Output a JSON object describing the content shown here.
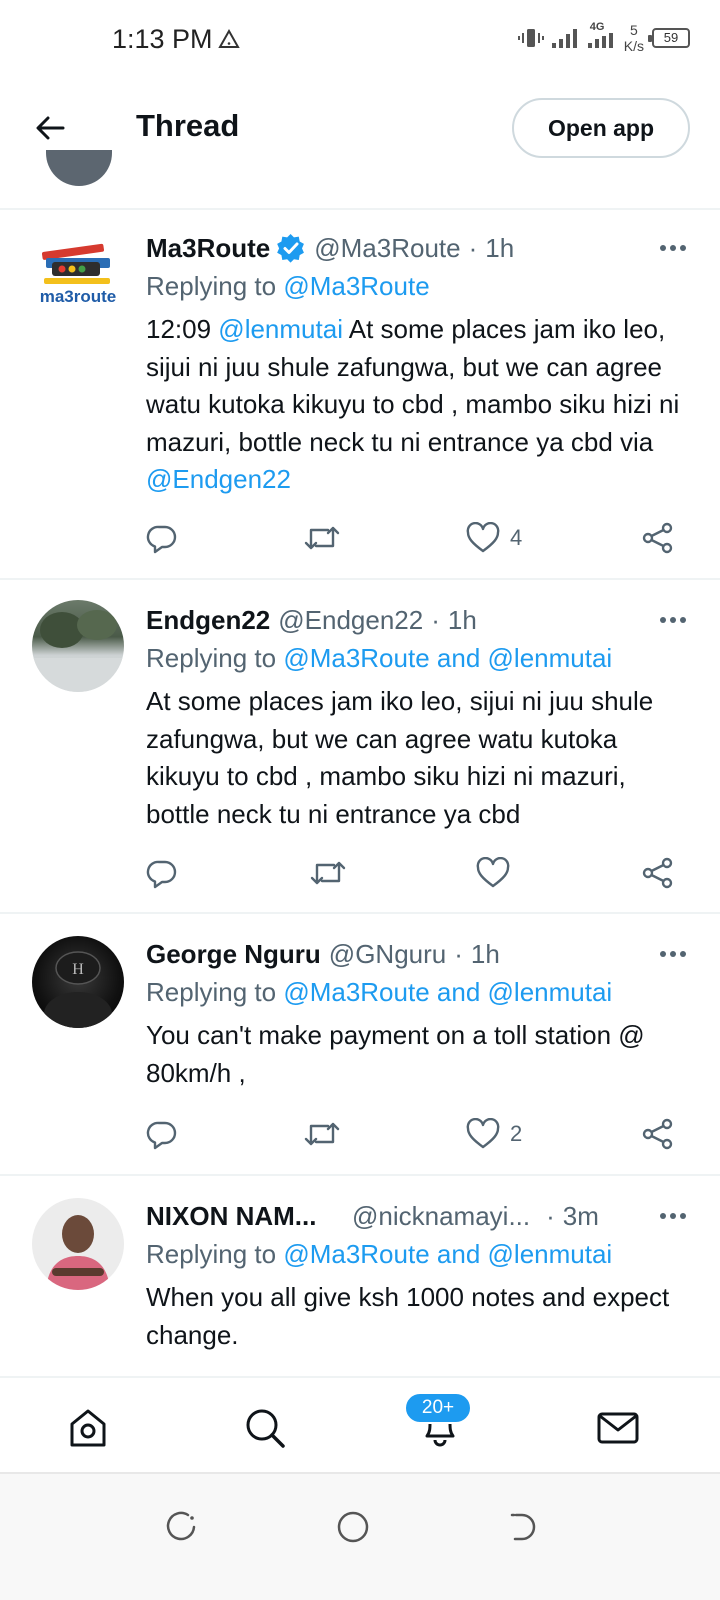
{
  "status": {
    "time": "1:13 PM",
    "net_type": "4G",
    "speed_value": "5",
    "speed_unit": "K/s",
    "battery": "59"
  },
  "header": {
    "title": "Thread",
    "open_app_label": "Open app"
  },
  "colors": {
    "link": "#1d9bf0",
    "verified": "#1d9bf0",
    "text": "#0f1419",
    "muted": "#536471"
  },
  "tweets": [
    {
      "name": "Ma3Route",
      "verified": true,
      "handle": "@Ma3Route",
      "dot": "·",
      "time": "1h",
      "replying_prefix": "Replying to",
      "replying_to": "@Ma3Route",
      "replying_and": "",
      "replying_to2": "",
      "body_parts": [
        "12:09 ",
        "@lenmutai",
        " At some places jam iko leo, sijui ni juu shule zafungwa, but we can agree watu kutoka kikuyu to cbd , mambo siku hizi ni mazuri, bottle neck tu ni entrance ya cbd via ",
        "@Endgen22"
      ],
      "likes": "4",
      "avatar_text": "ma3route"
    },
    {
      "name": "Endgen22",
      "handle": "@Endgen22",
      "dot": "·",
      "time": "1h",
      "replying_prefix": "Replying to",
      "replying_to": "@Ma3Route",
      "replying_and": "and",
      "replying_to2": "@lenmutai",
      "body": "At some places jam iko leo, sijui ni juu shule zafungwa, but we can agree watu kutoka kikuyu to cbd , mambo siku hizi ni mazuri, bottle neck tu ni entrance ya cbd",
      "likes": ""
    },
    {
      "name": "George Nguru",
      "handle": "@GNguru",
      "dot": "·",
      "time": "1h",
      "replying_prefix": "Replying to",
      "replying_to": "@Ma3Route",
      "replying_and": "and",
      "replying_to2": "@lenmutai",
      "body": "You can't make payment on a toll station @ 80km/h ,",
      "likes": "2"
    },
    {
      "name": "NIXON NAM...",
      "handle": "@nicknamayi...",
      "dot": "·",
      "time": "3m",
      "replying_prefix": "Replying to",
      "replying_to": "@Ma3Route",
      "replying_and": "and",
      "replying_to2": "@lenmutai",
      "body": "When you all give ksh 1000 notes and expect change."
    }
  ],
  "tabbar": {
    "notifications_badge": "20+"
  },
  "icons": [
    "back-arrow-icon",
    "more-icon",
    "reply-icon",
    "retweet-icon",
    "like-icon",
    "share-icon",
    "home-icon",
    "search-icon",
    "bell-icon",
    "mail-icon",
    "verified-icon"
  ]
}
